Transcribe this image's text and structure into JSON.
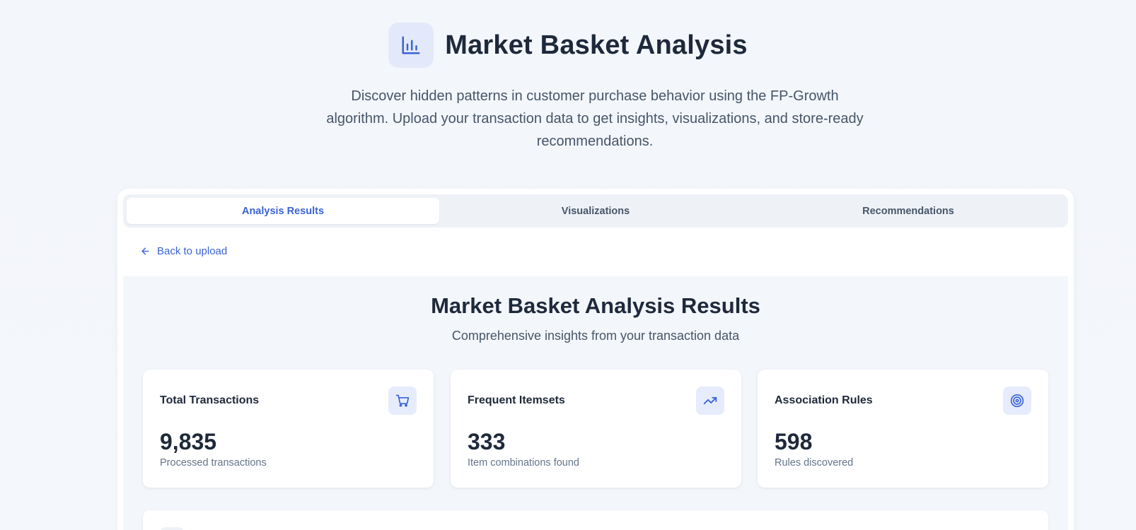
{
  "header": {
    "icon": "bar-chart-icon",
    "title": "Market Basket Analysis",
    "description": "Discover hidden patterns in customer purchase behavior using the FP-Growth algorithm. Upload your transaction data to get insights, visualizations, and store-ready recommendations."
  },
  "tabs": [
    {
      "label": "Analysis Results",
      "active": true
    },
    {
      "label": "Visualizations",
      "active": false
    },
    {
      "label": "Recommendations",
      "active": false
    }
  ],
  "back_link": {
    "label": "Back to upload",
    "icon": "arrow-left-icon"
  },
  "results": {
    "title": "Market Basket Analysis Results",
    "subtitle": "Comprehensive insights from your transaction data"
  },
  "stats": [
    {
      "label": "Total Transactions",
      "value": "9,835",
      "note": "Processed transactions",
      "icon": "shopping-cart-icon"
    },
    {
      "label": "Frequent Itemsets",
      "value": "333",
      "note": "Item combinations found",
      "icon": "trending-up-icon"
    },
    {
      "label": "Association Rules",
      "value": "598",
      "note": "Rules discovered",
      "icon": "target-icon"
    }
  ],
  "colors": {
    "accent": "#3b63d8",
    "text_dark": "#1e293b",
    "text_muted": "#64748b",
    "icon_bg": "#e6ecfb",
    "page_bg": "#f3f6fb"
  }
}
